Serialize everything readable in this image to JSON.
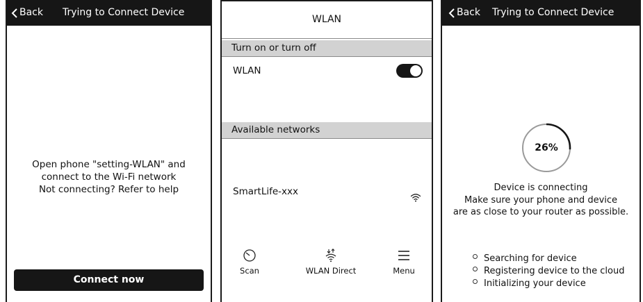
{
  "screens": {
    "connect": {
      "back_label": "Back",
      "title": "Trying to Connect Device",
      "instructions": {
        "line1": "Open phone \"setting-WLAN\" and",
        "line2": "connect to the Wi-Fi network",
        "line3": "Not connecting? Refer to help"
      },
      "connect_button": "Connect now"
    },
    "wlan": {
      "title": "WLAN",
      "section_toggle": "Turn on or turn off",
      "wlan_label": "WLAN",
      "wlan_enabled": true,
      "section_networks": "Available networks",
      "networks": [
        {
          "name": "SmartLife-xxx",
          "icon": "wifi-icon"
        }
      ],
      "nav": {
        "scan": "Scan",
        "wlan_direct": "WLAN Direct",
        "menu": "Menu"
      }
    },
    "connecting": {
      "back_label": "Back",
      "title": "Trying to Connect Device",
      "progress": 0.26,
      "progress_label": "26%",
      "status": {
        "line1": "Device is connecting",
        "line2": "Make sure your phone and device",
        "line3": "are as close to your router as possible."
      },
      "steps": [
        "Searching for device",
        "Registering device to the cloud",
        "Initializing your device"
      ]
    }
  },
  "colors": {
    "bar": "#161616",
    "section_bg": "#d2d2d2",
    "ring_track": "#9a9a9a",
    "ring_progress": "#161616"
  }
}
